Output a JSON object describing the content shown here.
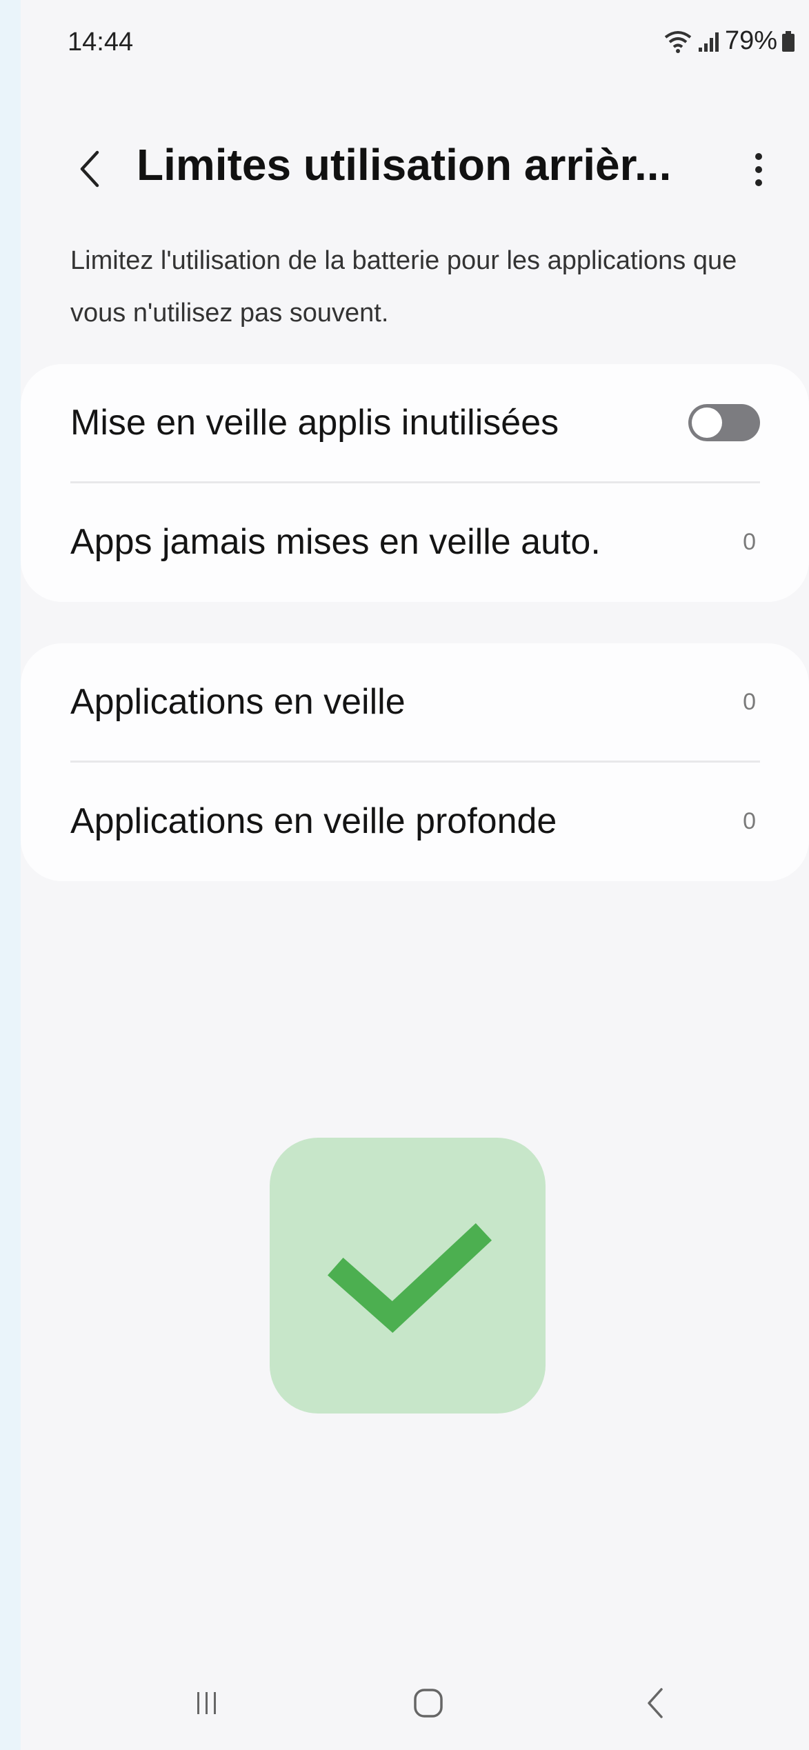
{
  "status_bar": {
    "time": "14:44",
    "battery": "79%",
    "icons": [
      "wifi-icon",
      "signal-icon",
      "battery-icon"
    ]
  },
  "header": {
    "title": "Limites utilisation arrièr...",
    "back_icon": "chevron-left-icon",
    "more_icon": "more-vert-icon"
  },
  "description": "Limitez l'utilisation de la batterie pour les applications que vous n'utilisez pas souvent.",
  "settings": {
    "group1": [
      {
        "label": "Mise en veille applis inutilisées",
        "toggle": false
      },
      {
        "label": "Apps jamais mises en veille auto.",
        "count": "0"
      }
    ],
    "group2": [
      {
        "label": "Applications en veille",
        "count": "0"
      },
      {
        "label": "Applications en veille profonde",
        "count": "0"
      }
    ]
  },
  "overlay": {
    "icon": "checkmark-icon",
    "badge_color": "#c7e6c9",
    "check_color": "#4caf50"
  },
  "nav_bar": {
    "icons": [
      "recents-icon",
      "home-icon",
      "back-icon"
    ]
  }
}
